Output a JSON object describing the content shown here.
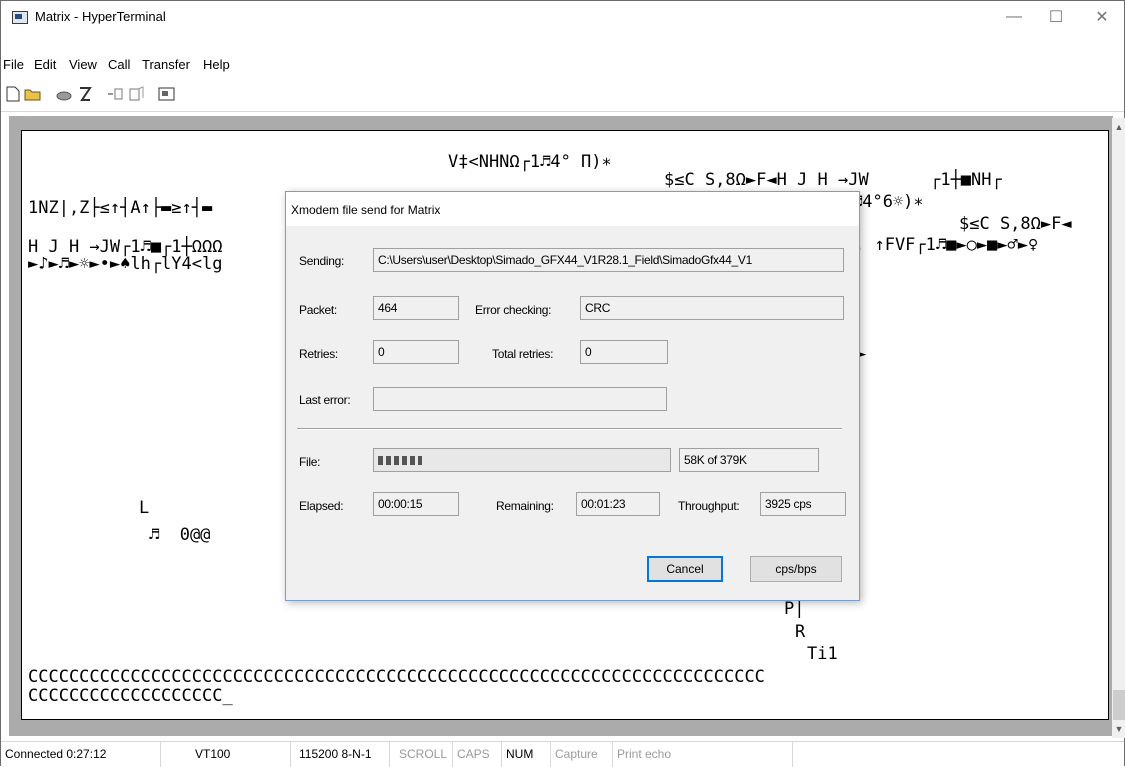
{
  "window": {
    "title": "Matrix - HyperTerminal",
    "minimize_glyph": "—",
    "maximize_glyph": "☐",
    "close_glyph": "✕"
  },
  "menu": [
    "File",
    "Edit",
    "View",
    "Call",
    "Transfer",
    "Help"
  ],
  "toolbar": {
    "icons": [
      "new-connection-icon",
      "open-icon",
      "call-icon",
      "disconnect-icon",
      "send-file-icon",
      "receive-file-icon",
      "properties-icon"
    ]
  },
  "terminal": {
    "lines": [
      "V‡<NHNΩ┌1♬4° Π)∗",
      "$≤C S,8Ω►F◄H J H →JW      ┌1┼■NH┌",
      "1NZ|,Z├≤↑┤A↑├▬≥↑┤▬",
      "♬4°6☼)∗",
      "$≤C S,8Ω►F◄",
      "H J H →JW┌1♬■┌1┼ΩΩΩ",
      ". ↑FVF┌1♬■►○►■►♂►♀",
      "►♪►♬►☼►•►♠lh┌lY4<lg",
      "►",
      "L",
      "♬  0@@",
      "P|",
      "R",
      "Ti1",
      "CCCCCCCCCCCCCCCCCCCCCCCCCCCCCCCCCCCCCCCCCCCCCCCCCCCCCCCCCCCCCCCCCCCCCCCC",
      "CCCCCCCCCCCCCCCCCCC_"
    ]
  },
  "statusbar": {
    "connected": "Connected 0:27:12",
    "emulation": "VT100",
    "settings": "115200 8-N-1",
    "scroll": "SCROLL",
    "caps": "CAPS",
    "num": "NUM",
    "capture": "Capture",
    "print_echo": "Print echo"
  },
  "dialog": {
    "title": "Xmodem file send for Matrix",
    "sending_label": "Sending:",
    "sending_value": "C:\\Users\\user\\Desktop\\Simado_GFX44_V1R28.1_Field\\SimadoGfx44_V1",
    "packet_label": "Packet:",
    "packet_value": "464",
    "error_checking_label": "Error checking:",
    "error_checking_value": "CRC",
    "retries_label": "Retries:",
    "retries_value": "0",
    "total_retries_label": "Total retries:",
    "total_retries_value": "0",
    "last_error_label": "Last error:",
    "last_error_value": "",
    "file_label": "File:",
    "file_progress": 0.153,
    "file_size_text": "58K of 379K",
    "elapsed_label": "Elapsed:",
    "elapsed_value": "00:00:15",
    "remaining_label": "Remaining:",
    "remaining_value": "00:01:23",
    "throughput_label": "Throughput:",
    "throughput_value": "3925 cps",
    "cancel_label": "Cancel",
    "cps_bps_label": "cps/bps"
  }
}
